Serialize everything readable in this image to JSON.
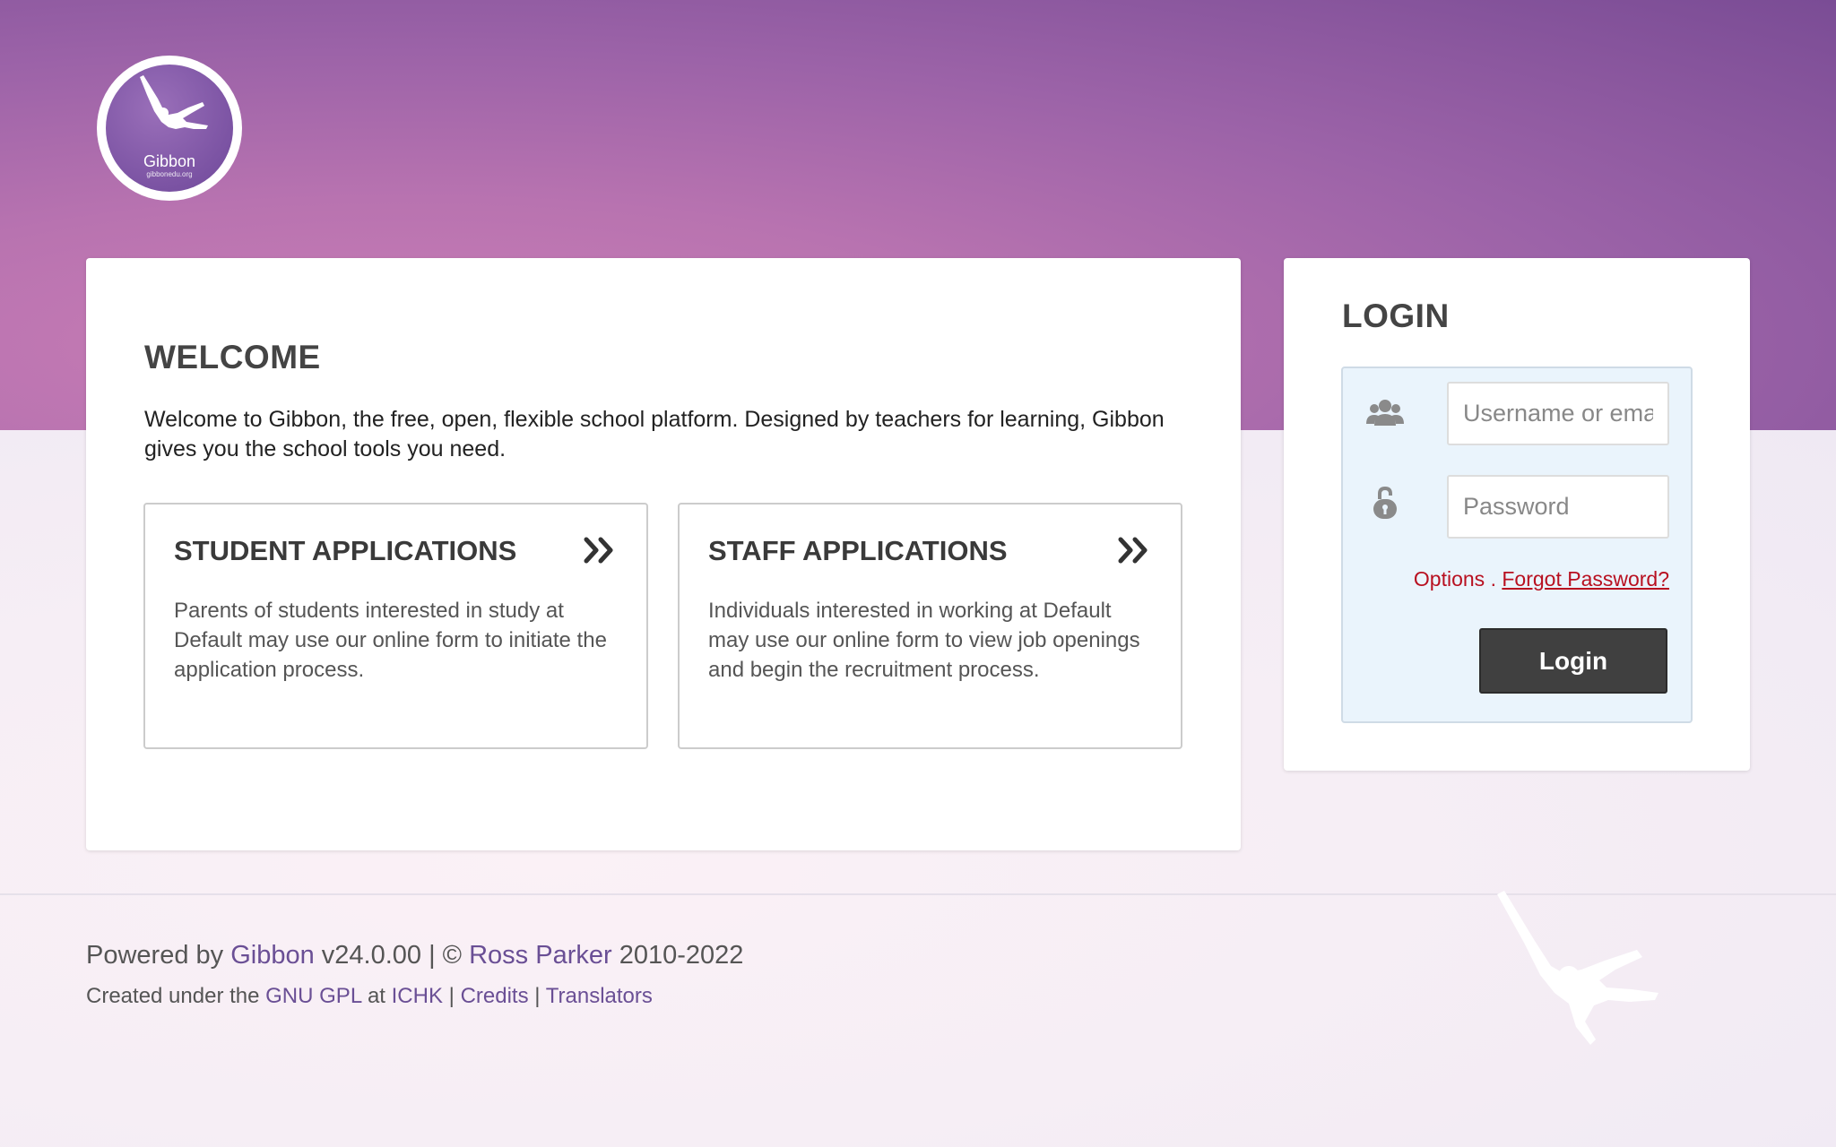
{
  "logo": {
    "name": "Gibbon",
    "url_text": "gibbonedu.org"
  },
  "welcome": {
    "title": "WELCOME",
    "text": "Welcome to Gibbon, the free, open, flexible school platform. Designed by teachers for learning, Gibbon gives you the school tools you need.",
    "applications": [
      {
        "title": "STUDENT APPLICATIONS",
        "description": "Parents of students interested in study at Default may use our online form to initiate the application process.",
        "icon": "double-chevron-right-icon"
      },
      {
        "title": "STAFF APPLICATIONS",
        "description": "Individuals interested in working at Default may use our online form to view job openings and begin the recruitment process.",
        "icon": "double-chevron-right-icon"
      }
    ]
  },
  "login": {
    "title": "LOGIN",
    "username_placeholder": "Username or email",
    "password_placeholder": "Password",
    "options_label": "Options",
    "separator": " . ",
    "forgot_label": "Forgot Password?",
    "button_label": "Login",
    "user_icon": "users-icon",
    "lock_icon": "lock-icon"
  },
  "footer": {
    "powered_by": "Powered by ",
    "gibbon_link": "Gibbon",
    "version": " v24.0.00 | © ",
    "author_link": "Ross Parker",
    "years": " 2010-2022",
    "created_under": "Created under the ",
    "license_link": "GNU GPL",
    "at": " at ",
    "org_link": "ICHK",
    "sep": " | ",
    "credits_link": "Credits",
    "translators_link": "Translators"
  },
  "colors": {
    "header_purple": "#9c63a8",
    "link_purple": "#6a4f95",
    "link_red": "#b81020",
    "login_button": "#404040",
    "form_background": "#eaf4fc"
  }
}
